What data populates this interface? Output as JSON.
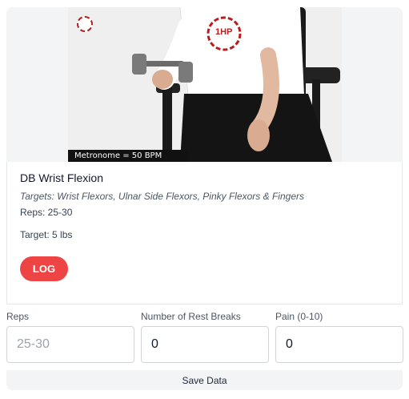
{
  "exercise": {
    "title": "DB Wrist Flexion",
    "targets": "Targets: Wrist Flexors, Ulnar Side Flexors, Pinky Flexors & Fingers",
    "reps": "Reps: 25-30",
    "target_weight": "Target: 5 lbs",
    "log_label": "LOG"
  },
  "video": {
    "metronome": "Metronome = 50 BPM",
    "logo_text": "1HP"
  },
  "form": {
    "reps": {
      "label": "Reps",
      "placeholder": "25-30",
      "value": ""
    },
    "rest_breaks": {
      "label": "Number of Rest Breaks",
      "value": "0"
    },
    "pain": {
      "label": "Pain (0-10)",
      "value": "0"
    },
    "save_label": "Save Data"
  },
  "colors": {
    "accent": "#ef4444",
    "card_bg": "#f3f4f6"
  }
}
